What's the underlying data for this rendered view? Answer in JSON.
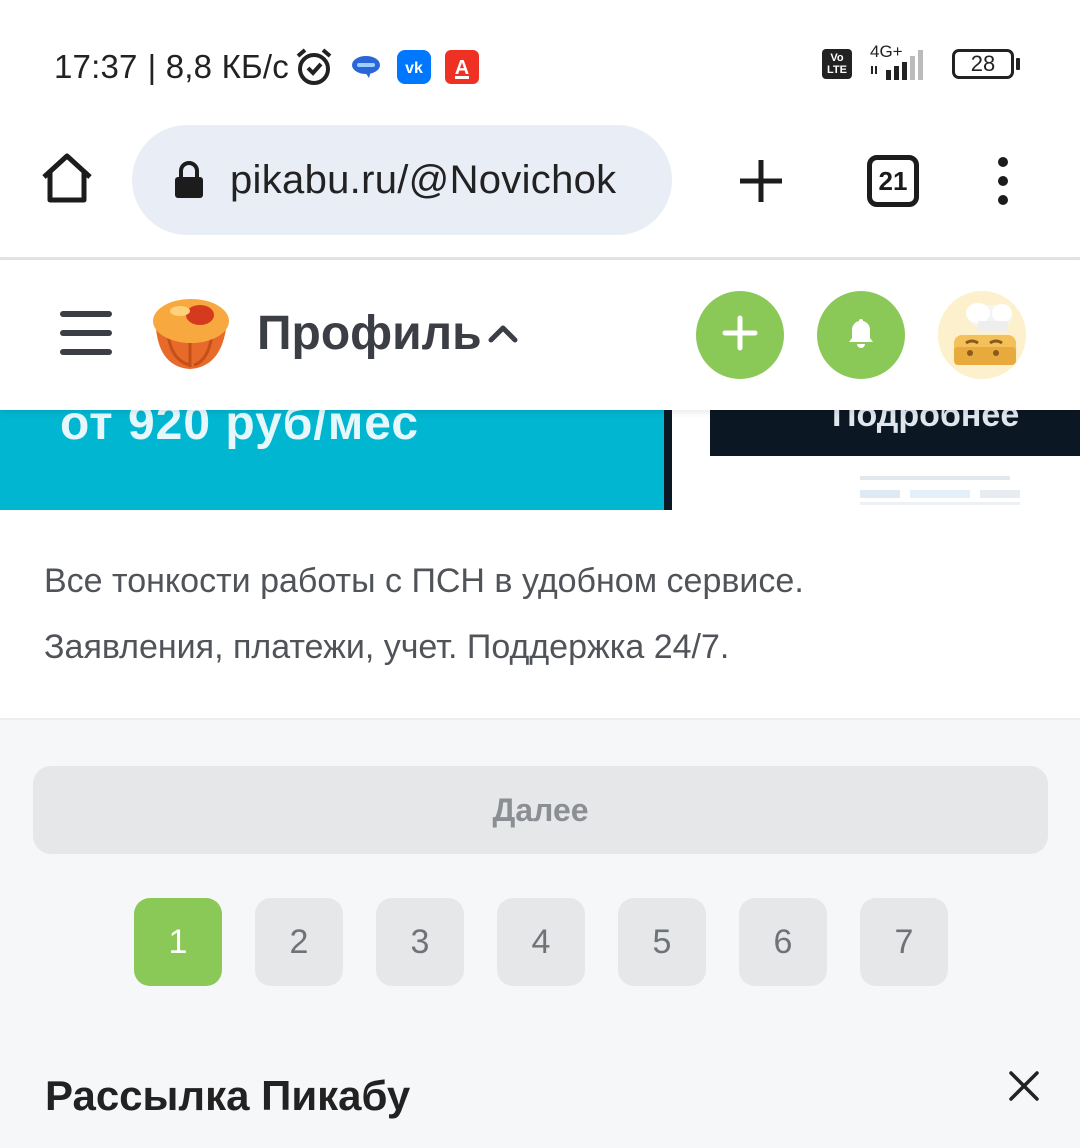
{
  "status_bar": {
    "time": "17:37",
    "speed": "| 8,8 КБ/с",
    "network_type": "4G+",
    "volte_label_top": "Vo",
    "volte_label_bottom": "LTE",
    "battery": "28",
    "icons": [
      "alarm-icon",
      "messages-icon",
      "vk-icon",
      "alfa-bank-icon",
      "volte-icon",
      "signal-icon",
      "battery-icon"
    ]
  },
  "browser": {
    "url": "pikabu.ru/@Novichok",
    "tab_count": "21"
  },
  "header": {
    "title": "Профиль",
    "colors": {
      "accent_green": "#8ac858"
    }
  },
  "ad": {
    "price_text": "от 920 руб/мес",
    "more_text": "Подробнее",
    "description_line1": "Все тонкости работы с ПСН в удобном сервисе.",
    "description_line2": "Заявления, платежи, учет. Поддержка 24/7."
  },
  "pagination": {
    "next_label": "Далее",
    "pages": [
      "1",
      "2",
      "3",
      "4",
      "5",
      "6",
      "7"
    ],
    "current_page": "1"
  },
  "newsletter": {
    "title": "Рассылка Пикабу"
  }
}
